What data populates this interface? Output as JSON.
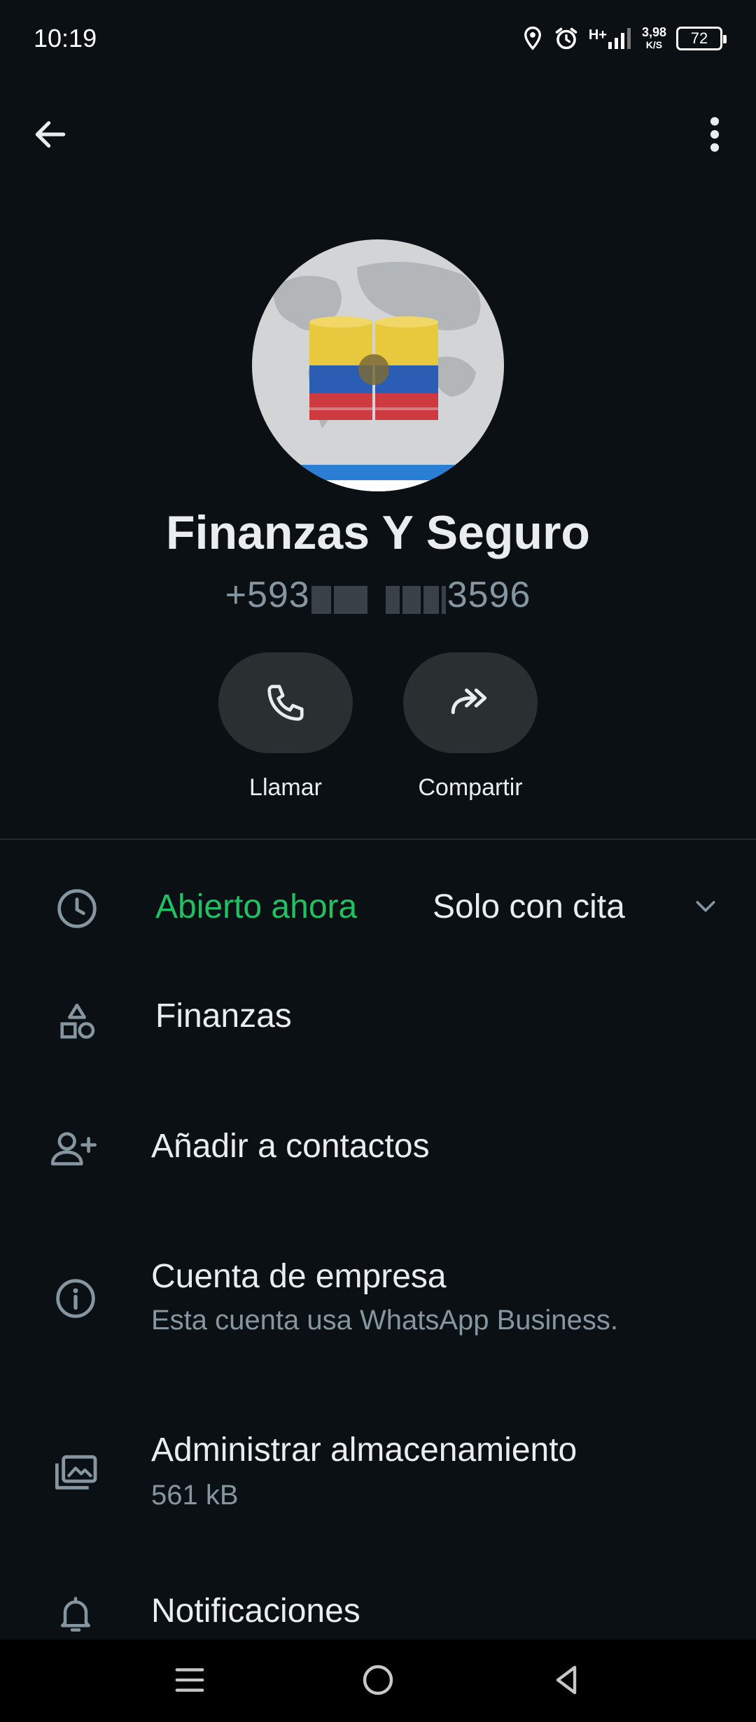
{
  "status_bar": {
    "time": "10:19",
    "network_label": "H+",
    "speed_value": "3,98",
    "speed_unit": "K/S",
    "battery": "72"
  },
  "app_bar": {
    "back_icon": "arrow-left-icon",
    "menu_icon": "more-vertical-icon"
  },
  "profile": {
    "name": "Finanzas Y Seguro",
    "phone_prefix": "+593",
    "phone_suffix": "3596",
    "avatar_icon": "business-avatar"
  },
  "actions": [
    {
      "label": "Llamar",
      "icon": "phone-icon"
    },
    {
      "label": "Compartir",
      "icon": "share-forward-icon"
    }
  ],
  "hours": {
    "status": "Abierto ahora",
    "note": "Solo con cita",
    "status_color": "#21c063"
  },
  "category": {
    "label": "Finanzas",
    "icon": "category-shapes-icon"
  },
  "add_contact": {
    "label": "Añadir a contactos",
    "icon": "add-person-icon"
  },
  "business_account": {
    "title": "Cuenta de empresa",
    "subtitle": "Esta cuenta usa WhatsApp Business.",
    "icon": "info-icon"
  },
  "storage": {
    "title": "Administrar almacenamiento",
    "subtitle": "561 kB",
    "icon": "media-folder-icon"
  },
  "notifications": {
    "label": "Notificaciones",
    "icon": "bell-icon"
  },
  "nav_bar": {
    "menu_icon": "recent-apps-icon",
    "home_icon": "home-icon",
    "back_icon": "back-triangle-icon"
  },
  "colors": {
    "background": "#0b1014",
    "accent_green": "#21c063",
    "secondary_text": "#8696a0",
    "button_bg": "#2a2f32"
  }
}
